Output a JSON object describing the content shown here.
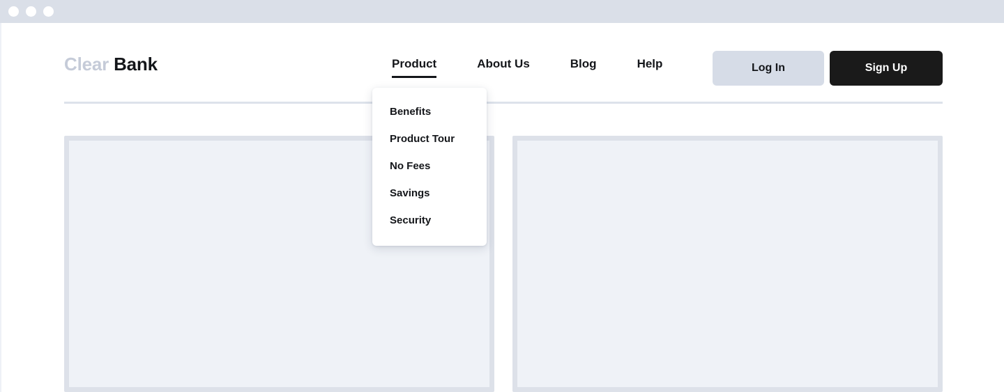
{
  "window": {
    "dots": [
      "window-dot-close",
      "window-dot-minimize",
      "window-dot-maximize"
    ]
  },
  "header": {
    "logo": {
      "first": "Clear",
      "second": "Bank",
      "first_color": "#c5cbd8",
      "second_color": "#14161a"
    },
    "nav": [
      {
        "label": "Product",
        "active": true,
        "name": "nav-item-product"
      },
      {
        "label": "About Us",
        "active": false,
        "name": "nav-item-about-us"
      },
      {
        "label": "Blog",
        "active": false,
        "name": "nav-item-blog"
      },
      {
        "label": "Help",
        "active": false,
        "name": "nav-item-help"
      }
    ],
    "actions": {
      "login_label": "Log In",
      "signup_label": "Sign Up",
      "login_bg": "#d6dce7",
      "signup_bg": "#1a1a1a"
    }
  },
  "dropdown": {
    "open": true,
    "parent": "Product",
    "items": [
      {
        "label": "Benefits"
      },
      {
        "label": "Product Tour"
      },
      {
        "label": "No Fees"
      },
      {
        "label": "Savings"
      },
      {
        "label": "Security"
      }
    ]
  },
  "main": {
    "panels": [
      {
        "name": "content-panel-left",
        "label": ""
      },
      {
        "name": "content-panel-right",
        "label": ""
      }
    ]
  },
  "theme": {
    "titlebar_bg": "#dadfe8",
    "divider": "#dde2eb",
    "panel_fill": "#eff2f7",
    "panel_border": "#dde1e9",
    "page_bg": "#ffffff"
  }
}
